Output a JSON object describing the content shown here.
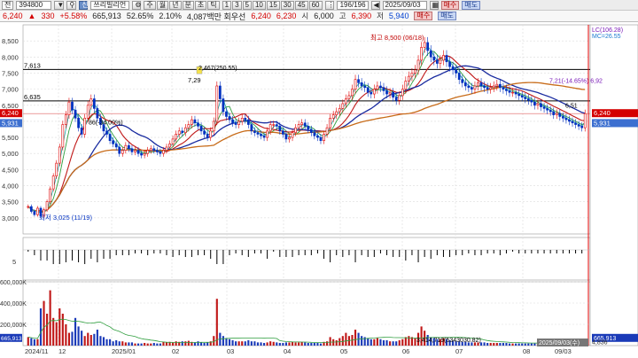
{
  "toolbar": {
    "stock_code": "394800",
    "market_toggle": "전",
    "stock_name": "쓰리빌리언",
    "periods": [
      "주",
      "월",
      "년",
      "분",
      "초",
      "틱"
    ],
    "intervals": [
      "1",
      "3",
      "5",
      "10",
      "15",
      "30",
      "45",
      "60"
    ],
    "count": "196/196",
    "date": "2025/09/03",
    "buy_label": "매수",
    "sell_label": "매도"
  },
  "quote": {
    "price": "6,240",
    "change": "330",
    "rate": "+5.58%",
    "volume": "665,913",
    "ratio1": "52.65%",
    "ratio2": "2.10%",
    "value_text": "4,087백만 회우선",
    "cur": "6,240",
    "bid": "6,230",
    "open_label": "시",
    "open": "6,000",
    "high_label": "고",
    "high": "6,390",
    "low_label": "저",
    "low": "5,940"
  },
  "chart_data": {
    "type": "candlestick",
    "x_labels": [
      "2024/11",
      "12",
      "2025/01",
      "02",
      "03",
      "04",
      "05",
      "06",
      "07",
      "08",
      "09/03"
    ],
    "price_ylim": [
      2500,
      9000
    ],
    "price_ticks": [
      "8,500",
      "8,000",
      "7,500",
      "7,000",
      "6,500",
      "6,000",
      "5,500",
      "5,000",
      "4,500",
      "4,000",
      "3,500",
      "3,000"
    ],
    "volume_ticks": [
      "600,000K",
      "400,000K",
      "200,000K"
    ],
    "volume_ylim": [
      0,
      600000
    ],
    "indicator_tick": "5",
    "hlines": [
      {
        "label": "7,613",
        "value": 7613
      },
      {
        "label": "6,635",
        "value": 6635
      }
    ],
    "hline_accent": {
      "label": "6,240",
      "value": 6240
    },
    "right_labels": {
      "top1": "LC(106.28)",
      "top2": "MC=26.55",
      "price_now": "6,240",
      "price_ma": "5,931",
      "left_price_now": "6,240",
      "left_price_ma": "5,931",
      "vol_now": "665,913",
      "vol_avg": "4,836",
      "bottom_date": "2025/09/03(수)"
    },
    "annotations": {
      "high": "최고 8,500 (06/18)",
      "low": "최저 3,025 (11/19)",
      "mid1": "7,29",
      "mid2": "2,467(250.55)",
      "mid3": "86(-34.00%)",
      "lc_text": "7,21(-14.65%) 6,92",
      "right_mark": "6,51",
      "vol_ann": "3,414,719(5343030.82)"
    },
    "close": [
      3350,
      3200,
      3100,
      3300,
      3050,
      3250,
      3500,
      3900,
      4300,
      4700,
      5200,
      5900,
      6200,
      6600,
      6350,
      6100,
      5800,
      5600,
      6100,
      6500,
      6700,
      6400,
      6100,
      5900,
      5700,
      5600,
      5400,
      5300,
      5200,
      5000,
      5100,
      5250,
      5150,
      5050,
      5100,
      5000,
      4950,
      5000,
      5100,
      5150,
      5100,
      5050,
      5000,
      5100,
      5200,
      5300,
      5450,
      5600,
      5700,
      5650,
      5800,
      5900,
      6050,
      5950,
      5850,
      5700,
      5600,
      5500,
      5700,
      6000,
      7100,
      6700,
      6300,
      6150,
      6050,
      5950,
      5900,
      6000,
      6100,
      6050,
      5900,
      5700,
      5650,
      5600,
      5550,
      5500,
      5700,
      5900,
      5900,
      5850,
      5700,
      5600,
      5450,
      5500,
      5650,
      5800,
      5900,
      5950,
      5850,
      5750,
      5650,
      5550,
      5500,
      5400,
      5600,
      5800,
      6100,
      6200,
      6300,
      6400,
      6550,
      6700,
      6800,
      7000,
      7300,
      7200,
      7100,
      7050,
      6900,
      6850,
      7000,
      7100,
      7050,
      6950,
      6850,
      6900,
      6750,
      6650,
      6800,
      7000,
      7250,
      7400,
      7500,
      7600,
      7900,
      8300,
      8450,
      8200,
      8000,
      7900,
      7800,
      7900,
      8050,
      7850,
      7700,
      7600,
      7500,
      7300,
      7200,
      7100,
      7050,
      7000,
      7100,
      7200,
      7100,
      7050,
      7000,
      7050,
      7100,
      7150,
      7050,
      7000,
      6950,
      6900,
      6900,
      6850,
      6800,
      6750,
      6700,
      6650,
      6600,
      6500,
      6550,
      6450,
      6400,
      6350,
      6300,
      6200,
      6250,
      6150,
      6100,
      6050,
      6000,
      5950,
      5900,
      5850,
      5800,
      6240
    ],
    "volumes": [
      80,
      70,
      60,
      60,
      350,
      420,
      300,
      520,
      260,
      220,
      350,
      300,
      200,
      120,
      130,
      260,
      180,
      140,
      90,
      120,
      100,
      110,
      150,
      90,
      80,
      60,
      60,
      40,
      50,
      40,
      40,
      30,
      30,
      30,
      20,
      20,
      20,
      25,
      20,
      20,
      25,
      20,
      20,
      35,
      30,
      35,
      30,
      40,
      35,
      40,
      40,
      45,
      35,
      30,
      40,
      30,
      25,
      30,
      40,
      90,
      440,
      120,
      90,
      70,
      60,
      50,
      40,
      40,
      40,
      40,
      50,
      40,
      40,
      30,
      30,
      25,
      30,
      40,
      35,
      30,
      25,
      25,
      30,
      30,
      35,
      30,
      30,
      35,
      30,
      25,
      25,
      25,
      25,
      20,
      35,
      40,
      80,
      60,
      50,
      70,
      90,
      120,
      90,
      100,
      150,
      120,
      90,
      80,
      70,
      60,
      60,
      70,
      60,
      50,
      50,
      40,
      40,
      40,
      50,
      60,
      80,
      90,
      80,
      70,
      120,
      180,
      140,
      100,
      80,
      70,
      60,
      60,
      70,
      60,
      50,
      45,
      40,
      40,
      35,
      35,
      30,
      30,
      30,
      30,
      30,
      30,
      25,
      25,
      25,
      25,
      25,
      25,
      25,
      20,
      20,
      20,
      20,
      20,
      20,
      20,
      20,
      20,
      20,
      20,
      20,
      20,
      20,
      20,
      18,
      18,
      18,
      18,
      18,
      18,
      18,
      18,
      18,
      30
    ]
  }
}
